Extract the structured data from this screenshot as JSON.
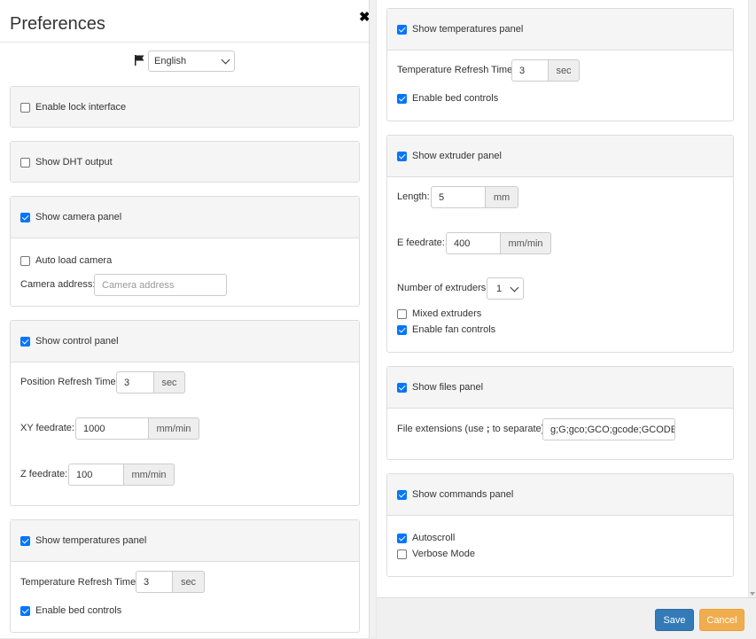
{
  "dialog": {
    "title": "Preferences",
    "close_glyph": "✖"
  },
  "language": {
    "selected": "English"
  },
  "left": {
    "lock": {
      "label": "Enable lock interface",
      "checked": false
    },
    "dht": {
      "label": "Show DHT output",
      "checked": false
    },
    "camera": {
      "label": "Show camera panel",
      "checked": true,
      "autoload_label": "Auto load camera",
      "autoload_checked": false,
      "address_label": "Camera address:",
      "address_placeholder": "Camera address"
    },
    "control": {
      "label": "Show control panel",
      "checked": true,
      "position_refresh_label": "Position Refresh Time:",
      "position_refresh_value": "3",
      "position_refresh_unit": "sec",
      "xy_label": "XY feedrate:",
      "xy_value": "1000",
      "xy_unit": "mm/min",
      "z_label": "Z feedrate:",
      "z_value": "100",
      "z_unit": "mm/min"
    },
    "temps": {
      "label": "Show temperatures panel",
      "checked": true,
      "refresh_label": "Temperature Refresh Time:",
      "refresh_value": "3",
      "refresh_unit": "sec",
      "bed_label": "Enable bed controls",
      "bed_checked": true
    }
  },
  "right": {
    "temps": {
      "label": "Show temperatures panel",
      "checked": true,
      "refresh_label": "Temperature Refresh Time:",
      "refresh_value": "3",
      "refresh_unit": "sec",
      "bed_label": "Enable bed controls",
      "bed_checked": true
    },
    "extruder": {
      "label": "Show extruder panel",
      "checked": true,
      "length_label": "Length:",
      "length_value": "5",
      "length_unit": "mm",
      "efeed_label": "E feedrate:",
      "efeed_value": "400",
      "efeed_unit": "mm/min",
      "count_label": "Number of extruders:",
      "count_value": "1",
      "mixed_label": "Mixed extruders",
      "mixed_checked": false,
      "fan_label": "Enable fan controls",
      "fan_checked": true
    },
    "files": {
      "label": "Show files panel",
      "checked": true,
      "ext_label_pre": "File extensions (use ",
      "ext_label_sep": ";",
      "ext_label_post": " to separate):",
      "ext_value": "g;G;gco;GCO;gcode;GCODE"
    },
    "commands": {
      "label": "Show commands panel",
      "checked": true,
      "autoscroll_label": "Autoscroll",
      "autoscroll_checked": true,
      "verbose_label": "Verbose Mode",
      "verbose_checked": false
    }
  },
  "footer": {
    "save_label": "Save",
    "cancel_label": "Cancel"
  },
  "colors": {
    "primary": "#337ab7",
    "warning": "#f0ad4e",
    "checkbox_on": "#0075ff"
  }
}
